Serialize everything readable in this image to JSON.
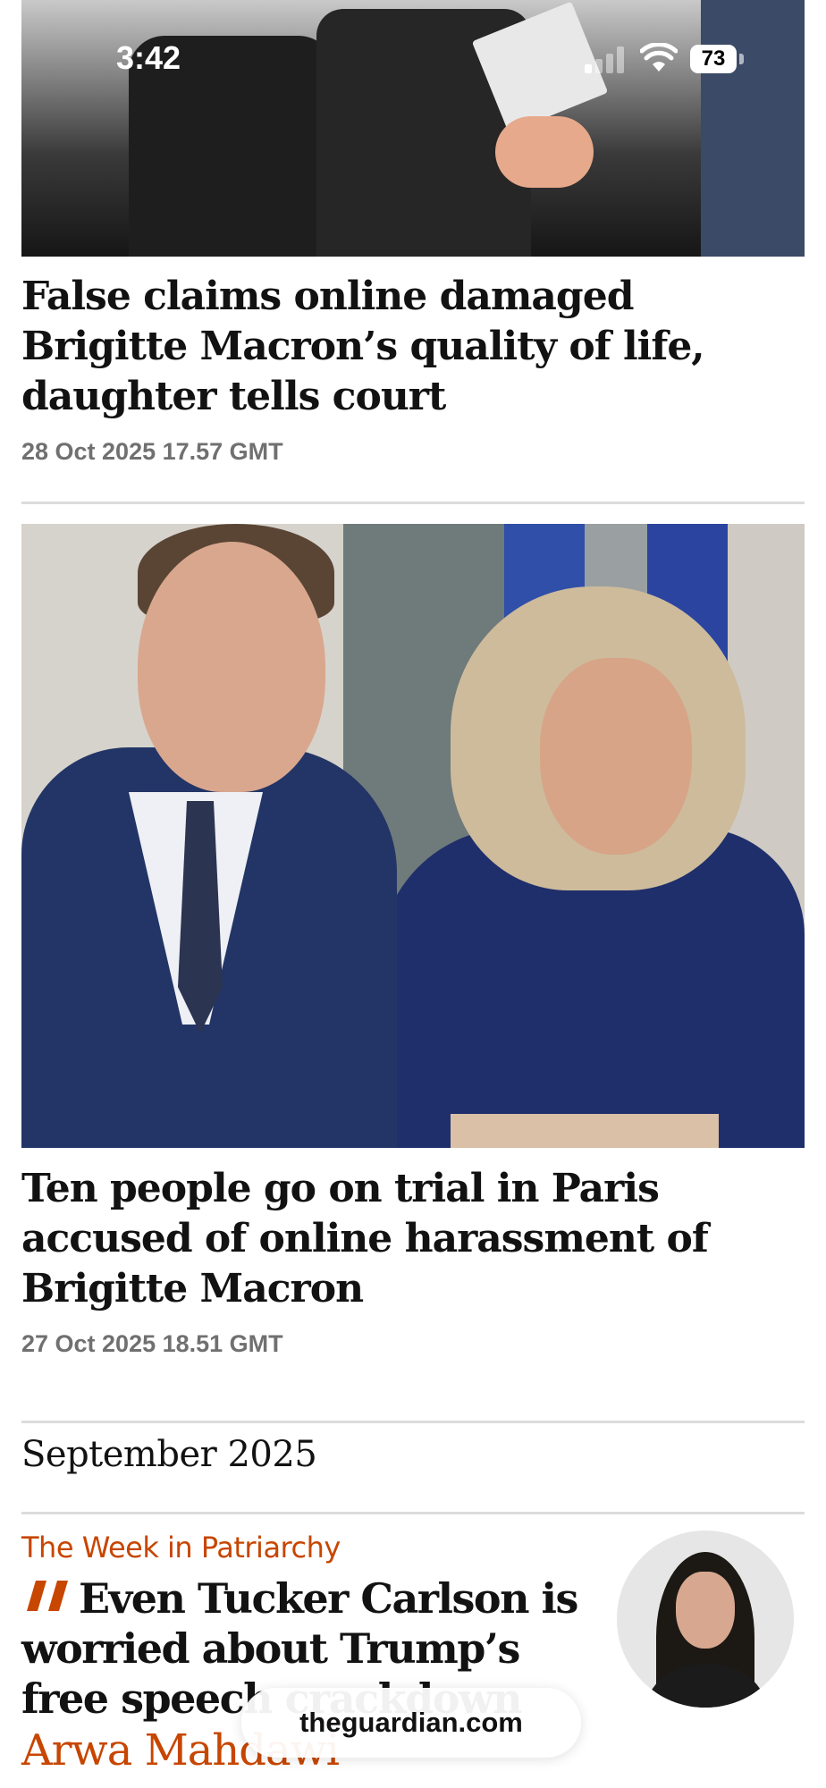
{
  "status_bar": {
    "time": "3:42",
    "battery": "73"
  },
  "articles": [
    {
      "headline": "False claims online damaged Brigitte Macron’s quality of life, daughter tells court",
      "date": "28 Oct 2025 17.57 GMT"
    },
    {
      "headline": "Ten people go on trial in Paris accused of online harassment of Brigitte Macron",
      "date": "27 Oct 2025 18.51 GMT"
    }
  ],
  "section": {
    "title": "September 2025"
  },
  "opinion": {
    "kicker": "The Week in Patriarchy",
    "headline": "Even Tucker Carlson is worried about Trump’s free speech crackdown",
    "byline": "Arwa Mahdawi"
  },
  "browser": {
    "url": "theguardian.com"
  },
  "colors": {
    "accent": "#c74600",
    "date_gray": "#707070",
    "divider": "#dcdcdc"
  }
}
